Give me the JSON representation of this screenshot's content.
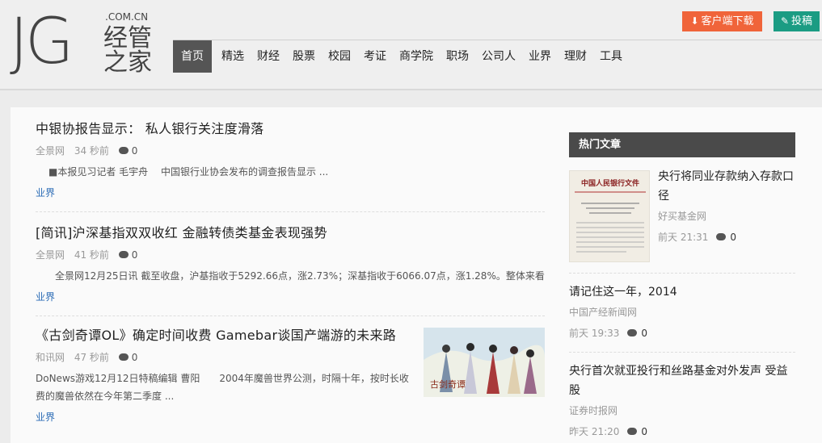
{
  "logo": {
    "jg": "JG",
    "domain": ".COM.CN",
    "cn_line1": "经管",
    "cn_line2": "之家"
  },
  "header": {
    "download_label": "客户端下载",
    "post_label": "投稿",
    "download_color": "#f0643a",
    "post_color": "#1b9c83"
  },
  "nav": {
    "items": [
      "首页",
      "精选",
      "财经",
      "股票",
      "校园",
      "考证",
      "商学院",
      "职场",
      "公司人",
      "业界",
      "理财",
      "工具"
    ],
    "active": "首页"
  },
  "articles": [
    {
      "title": "中银协报告显示： 私人银行关注度滑落",
      "source": "全景网",
      "time": "34 秒前",
      "comments": "0",
      "summary": "■本报见习记者 毛宇舟　 中国银行业协会发布的调查报告显示 ...",
      "tag": "业界"
    },
    {
      "title": "[简讯]沪深基指双双收红 金融转债类基金表现强势",
      "source": "全景网",
      "time": "41 秒前",
      "comments": "0",
      "summary": "全景网12月25日讯 截至收盘，沪基指收于5292.66点，涨2.73%；深基指收于6066.07点，涨1.28%。整体来看 ...",
      "tag": "业界"
    },
    {
      "title": "《古剑奇谭OL》确定时间收费 Gamebar谈国产端游的未来路",
      "source": "和讯网",
      "time": "47 秒前",
      "comments": "0",
      "summary": "DoNews游戏12月12日特稿编辑 曹阳　　2004年魔兽世界公测，时隔十年，按时长收费的魔兽依然在今年第二季度 ...",
      "tag": "业界",
      "thumb_caption": "古剑奇谭"
    }
  ],
  "sidebar": {
    "heading": "热门文章",
    "thumb_doc_title": "中国人民银行文件",
    "items": [
      {
        "title": "央行将同业存款纳入存款口径",
        "source": "好买基金网",
        "time": "前天 21:31",
        "comments": "0"
      },
      {
        "title": "请记住这一年，2014",
        "source": "中国产经新闻网",
        "time": "前天 19:33",
        "comments": "0"
      },
      {
        "title": "央行首次就亚投行和丝路基金对外发声 受益股",
        "source": "证券时报网",
        "time": "昨天 21:20",
        "comments": "0"
      }
    ]
  }
}
